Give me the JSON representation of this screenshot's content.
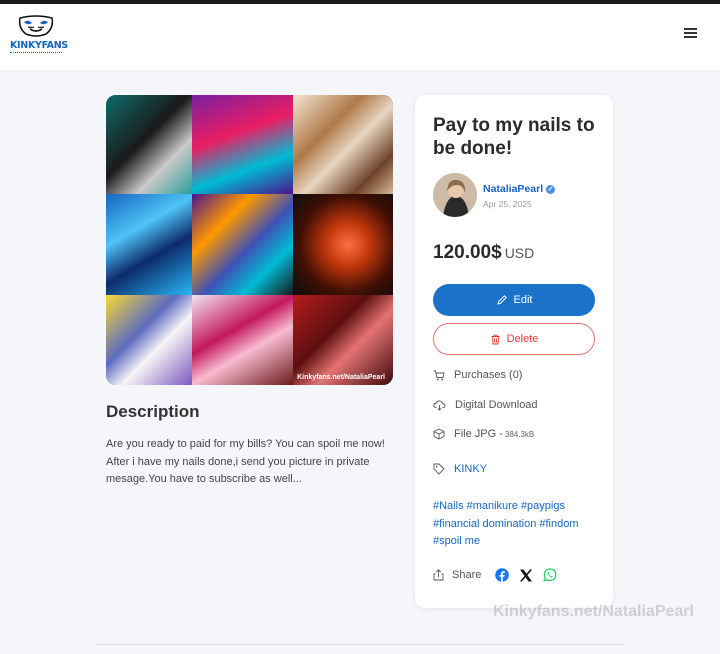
{
  "header": {
    "logo_text": "KINKYFANS",
    "menu_icon": "hamburger-menu-icon"
  },
  "media": {
    "image_caption": "Kinkyfans.net/NataliaPearl"
  },
  "description": {
    "title": "Description",
    "text": "Are you ready to paid for my bills? You can spoil me now! After i have my nails done,i send you picture in private mesage.You have to subscribe as well..."
  },
  "post": {
    "title": "Pay to my nails to be done!",
    "author": "NataliaPearl",
    "date": "Apr 25, 2025",
    "price": "120.00$",
    "currency": "USD",
    "edit_label": "Edit",
    "delete_label": "Delete",
    "purchases": "Purchases (0)",
    "delivery": "Digital Download",
    "file_type": "File JPG - ",
    "file_size": "384.3kB",
    "category": "KINKY",
    "tags": [
      "#Nails",
      "#manikure",
      "#paypigs",
      "#financial domination",
      "#findom",
      "#spoil me"
    ],
    "share_label": "Share"
  },
  "watermark": "Kinkyfans.net/NataliaPearl",
  "colors": {
    "accent": "#1a73c9",
    "danger": "#e53935",
    "link": "#1565c0"
  }
}
